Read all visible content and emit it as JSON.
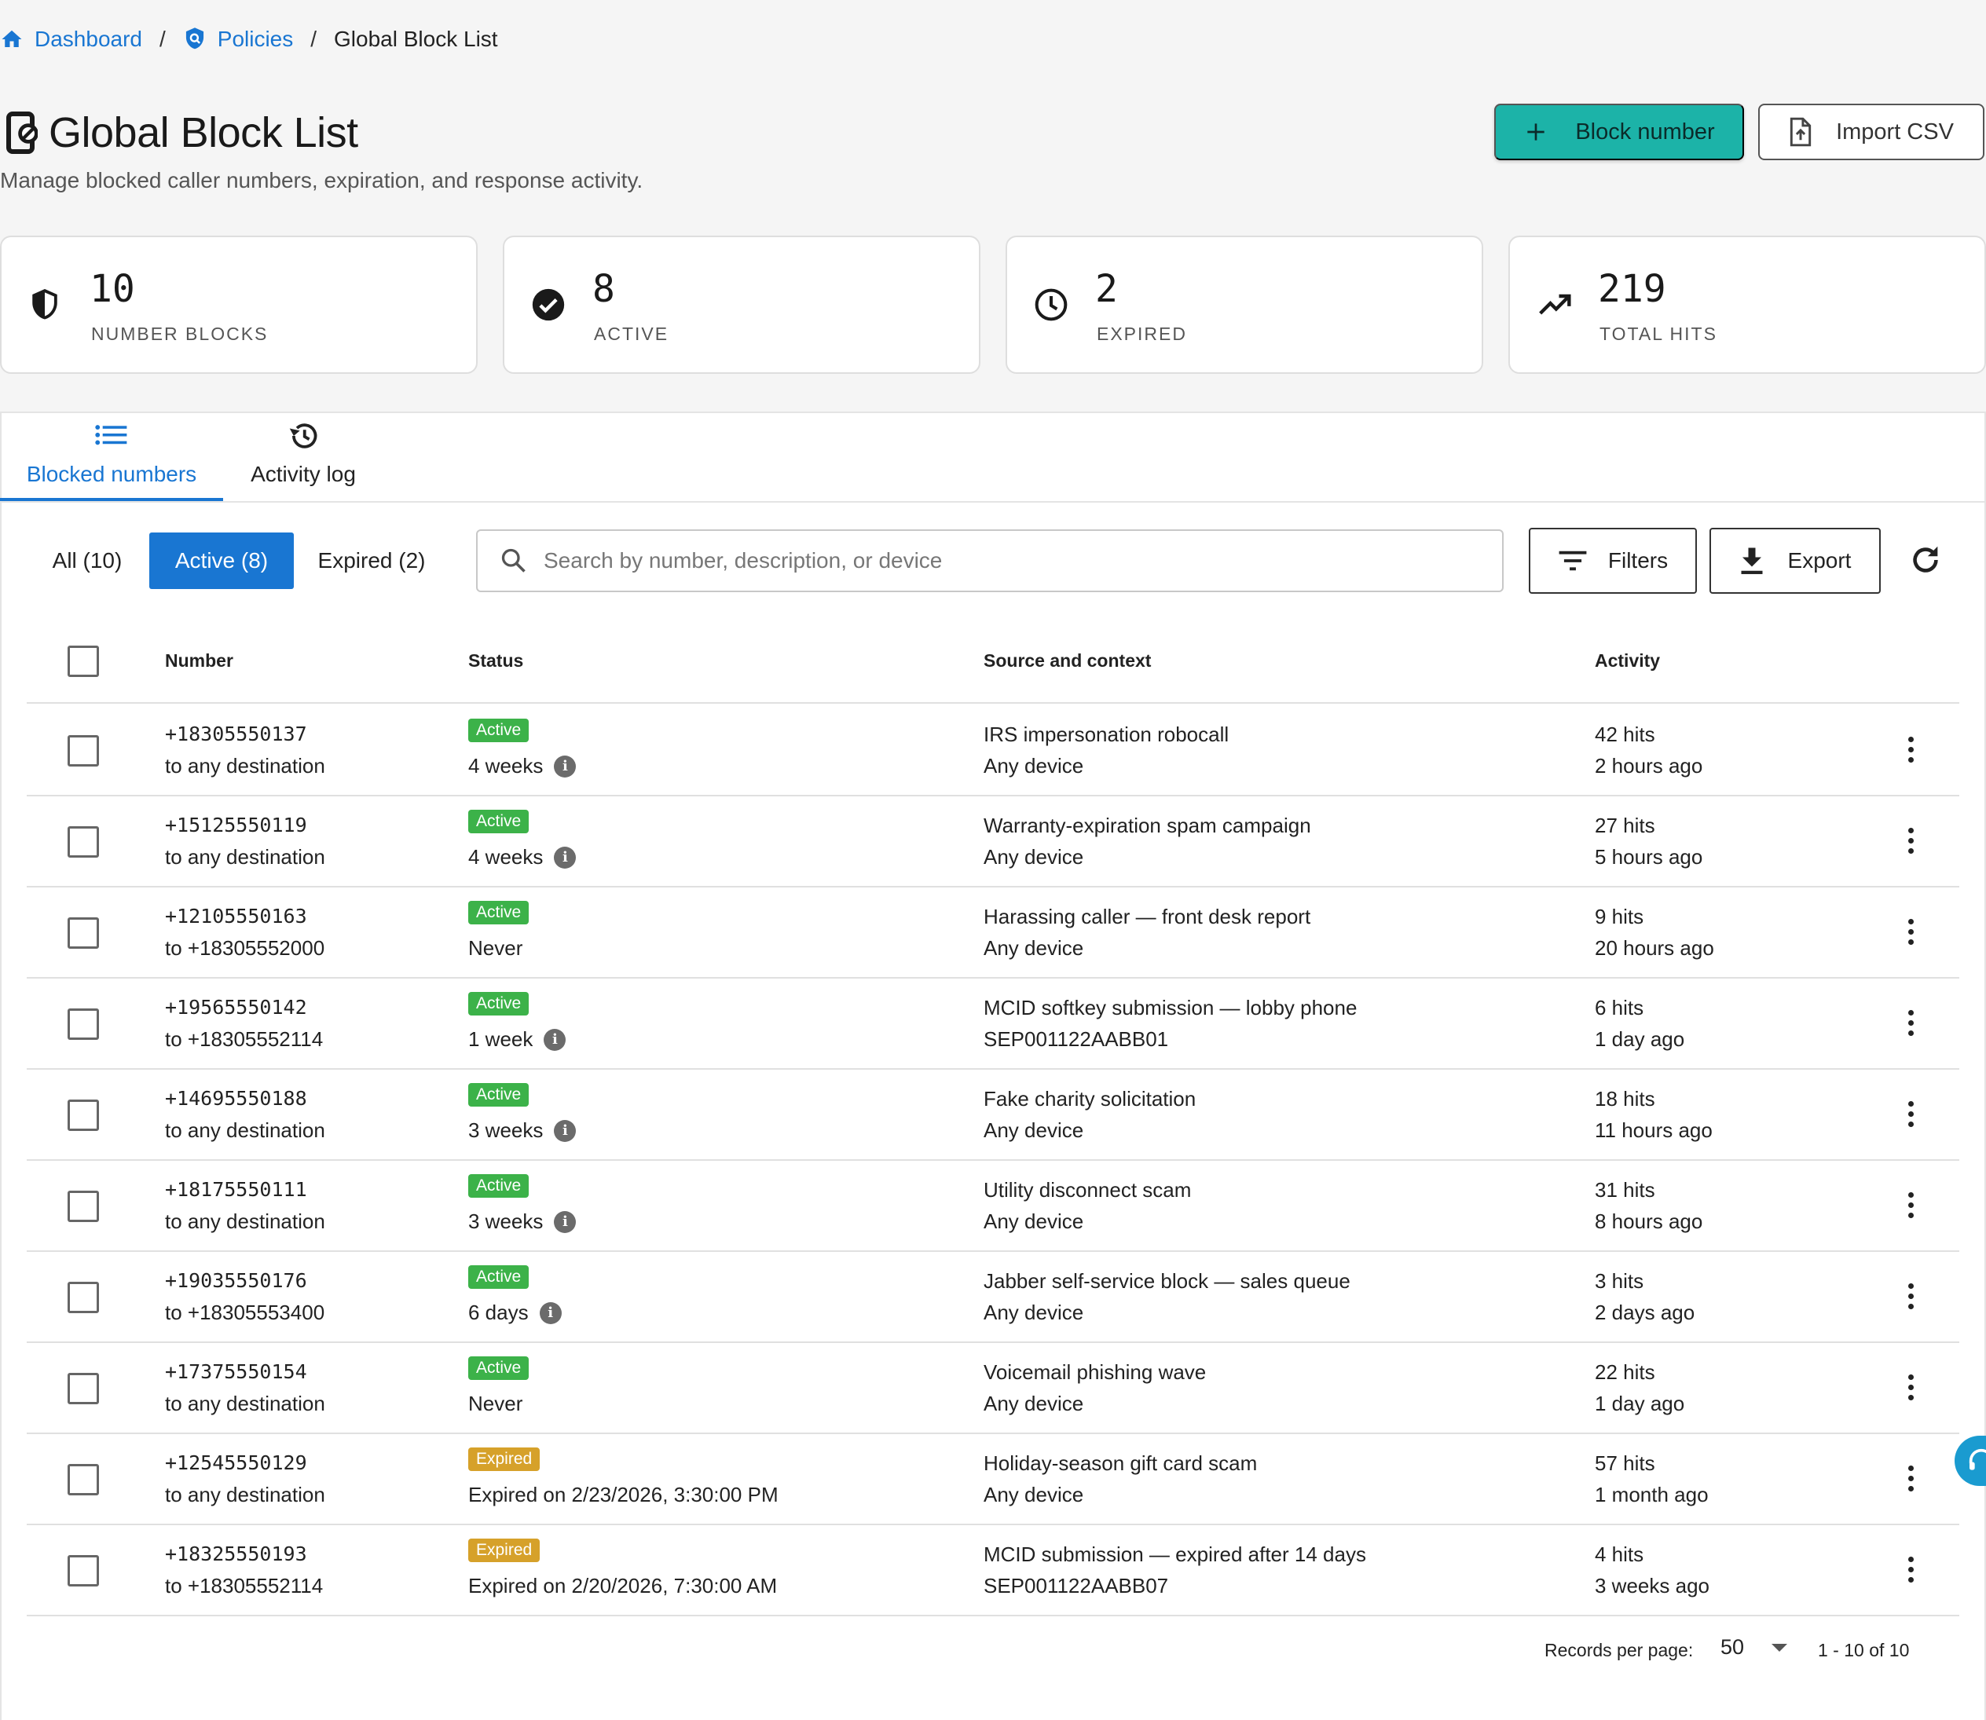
{
  "breadcrumb": {
    "items": [
      {
        "label": "Dashboard",
        "icon": "home-icon"
      },
      {
        "label": "Policies",
        "icon": "shield-search-icon"
      }
    ],
    "separator": "/",
    "current": "Global Block List"
  },
  "header": {
    "title": "Global Block List",
    "subtitle": "Manage blocked caller numbers, expiration, and response activity.",
    "primary_button": "Block number",
    "secondary_button": "Import CSV"
  },
  "stats": [
    {
      "value": "10",
      "label": "NUMBER BLOCKS",
      "icon": "shield-icon"
    },
    {
      "value": "8",
      "label": "ACTIVE",
      "icon": "check-circle-icon"
    },
    {
      "value": "2",
      "label": "EXPIRED",
      "icon": "clock-icon"
    },
    {
      "value": "219",
      "label": "TOTAL HITS",
      "icon": "trending-up-icon"
    }
  ],
  "tabs": [
    {
      "label": "Blocked numbers",
      "icon": "list-icon",
      "active": true
    },
    {
      "label": "Activity log",
      "icon": "history-icon",
      "active": false
    }
  ],
  "filters": {
    "segments": [
      "All (10)",
      "Active (8)",
      "Expired (2)"
    ],
    "selected": "Active (8)",
    "search_placeholder": "Search by number, description, or device",
    "filters_button": "Filters",
    "export_button": "Export"
  },
  "table": {
    "columns": [
      "Number",
      "Status",
      "Source and context",
      "Activity"
    ],
    "rows": [
      {
        "number": "+18305550137",
        "destination": "to any destination",
        "status": "Active",
        "duration": "4 weeks",
        "info": true,
        "source": "IRS impersonation robocall",
        "device": "Any device",
        "hits": "42 hits",
        "last": "2 hours ago"
      },
      {
        "number": "+15125550119",
        "destination": "to any destination",
        "status": "Active",
        "duration": "4 weeks",
        "info": true,
        "source": "Warranty-expiration spam campaign",
        "device": "Any device",
        "hits": "27 hits",
        "last": "5 hours ago"
      },
      {
        "number": "+12105550163",
        "destination": "to +18305552000",
        "status": "Active",
        "duration": "Never",
        "info": false,
        "source": "Harassing caller — front desk report",
        "device": "Any device",
        "hits": "9 hits",
        "last": "20 hours ago"
      },
      {
        "number": "+19565550142",
        "destination": "to +18305552114",
        "status": "Active",
        "duration": "1 week",
        "info": true,
        "source": "MCID softkey submission — lobby phone",
        "device": "SEP001122AABB01",
        "hits": "6 hits",
        "last": "1 day ago"
      },
      {
        "number": "+14695550188",
        "destination": "to any destination",
        "status": "Active",
        "duration": "3 weeks",
        "info": true,
        "source": "Fake charity solicitation",
        "device": "Any device",
        "hits": "18 hits",
        "last": "11 hours ago"
      },
      {
        "number": "+18175550111",
        "destination": "to any destination",
        "status": "Active",
        "duration": "3 weeks",
        "info": true,
        "source": "Utility disconnect scam",
        "device": "Any device",
        "hits": "31 hits",
        "last": "8 hours ago"
      },
      {
        "number": "+19035550176",
        "destination": "to +18305553400",
        "status": "Active",
        "duration": "6 days",
        "info": true,
        "source": "Jabber self-service block — sales queue",
        "device": "Any device",
        "hits": "3 hits",
        "last": "2 days ago"
      },
      {
        "number": "+17375550154",
        "destination": "to any destination",
        "status": "Active",
        "duration": "Never",
        "info": false,
        "source": "Voicemail phishing wave",
        "device": "Any device",
        "hits": "22 hits",
        "last": "1 day ago"
      },
      {
        "number": "+12545550129",
        "destination": "to any destination",
        "status": "Expired",
        "duration": "Expired on 2/23/2026, 3:30:00 PM",
        "info": false,
        "source": "Holiday-season gift card scam",
        "device": "Any device",
        "hits": "57 hits",
        "last": "1 month ago"
      },
      {
        "number": "+18325550193",
        "destination": "to +18305552114",
        "status": "Expired",
        "duration": "Expired on 2/20/2026, 7:30:00 AM",
        "info": false,
        "source": "MCID submission — expired after 14 days",
        "device": "SEP001122AABB07",
        "hits": "4 hits",
        "last": "3 weeks ago"
      }
    ]
  },
  "pagination": {
    "label": "Records per page:",
    "per_page": "50",
    "range": "1 - 10 of 10"
  },
  "colors": {
    "primary": "#1976d2",
    "accent": "#1cb3a8",
    "active_badge": "#3cb249",
    "expired_badge": "#d6a12a"
  }
}
